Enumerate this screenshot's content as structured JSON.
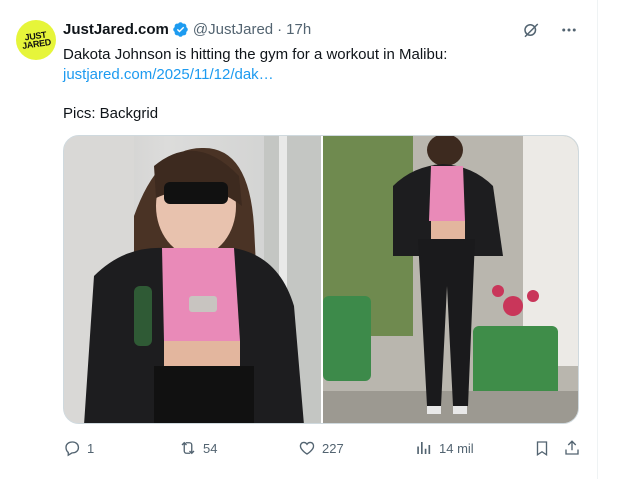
{
  "avatar": {
    "text": "JUST\nJARED"
  },
  "tweet": {
    "author_name": "JustJared.com",
    "handle": "@JustJared",
    "separator": "·",
    "time": "17h",
    "text": "Dakota Johnson is hitting the gym for a workout in Malibu:",
    "link": "justjared.com/2025/11/12/dak…",
    "pics_credit": "Pics: Backgrid"
  },
  "stats": {
    "replies": "1",
    "reposts": "54",
    "likes": "227",
    "views": "14 mil"
  },
  "colors": {
    "link": "#1d9bf0",
    "verified": "#1d9bf0",
    "muted": "#536471",
    "avatar_bg": "#e6f53a",
    "top_pink": "#e98ab8"
  },
  "icons": [
    "grok-icon",
    "more-icon",
    "reply-icon",
    "repost-icon",
    "like-icon",
    "views-icon",
    "bookmark-icon",
    "share-icon",
    "verified-icon"
  ]
}
